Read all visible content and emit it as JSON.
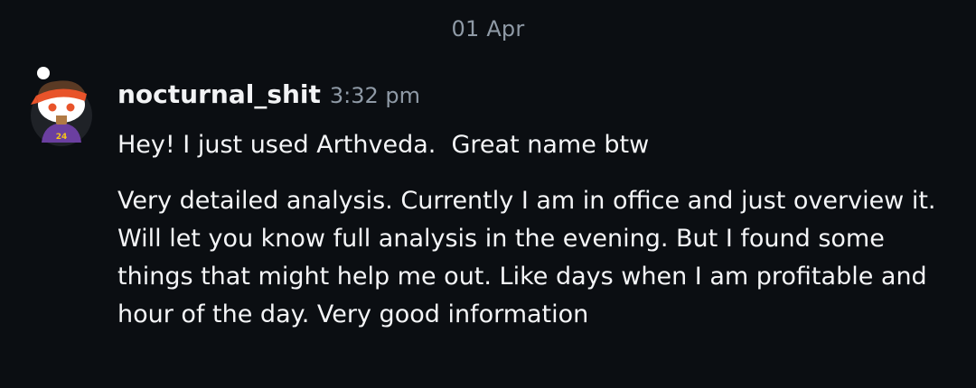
{
  "date_divider": "01 Apr",
  "message": {
    "author": "nocturnal_shit",
    "time": "3:32 pm",
    "line1": "Hey! I just used Arthveda.  Great name btw",
    "paragraph": "Very detailed analysis. Currently I am in office and just overview it. Will let you know full analysis in the evening. But I found some things that might help me out. Like days when I am profitable and hour of the day. Very good information",
    "avatar_icon": "reddit-snoo-avatar-icon"
  },
  "colors": {
    "background": "#0b0e12",
    "text": "#f2f3f5",
    "muted": "#8f9aa6",
    "avatar_orange": "#e8532a",
    "avatar_purple": "#6b3fa0"
  }
}
